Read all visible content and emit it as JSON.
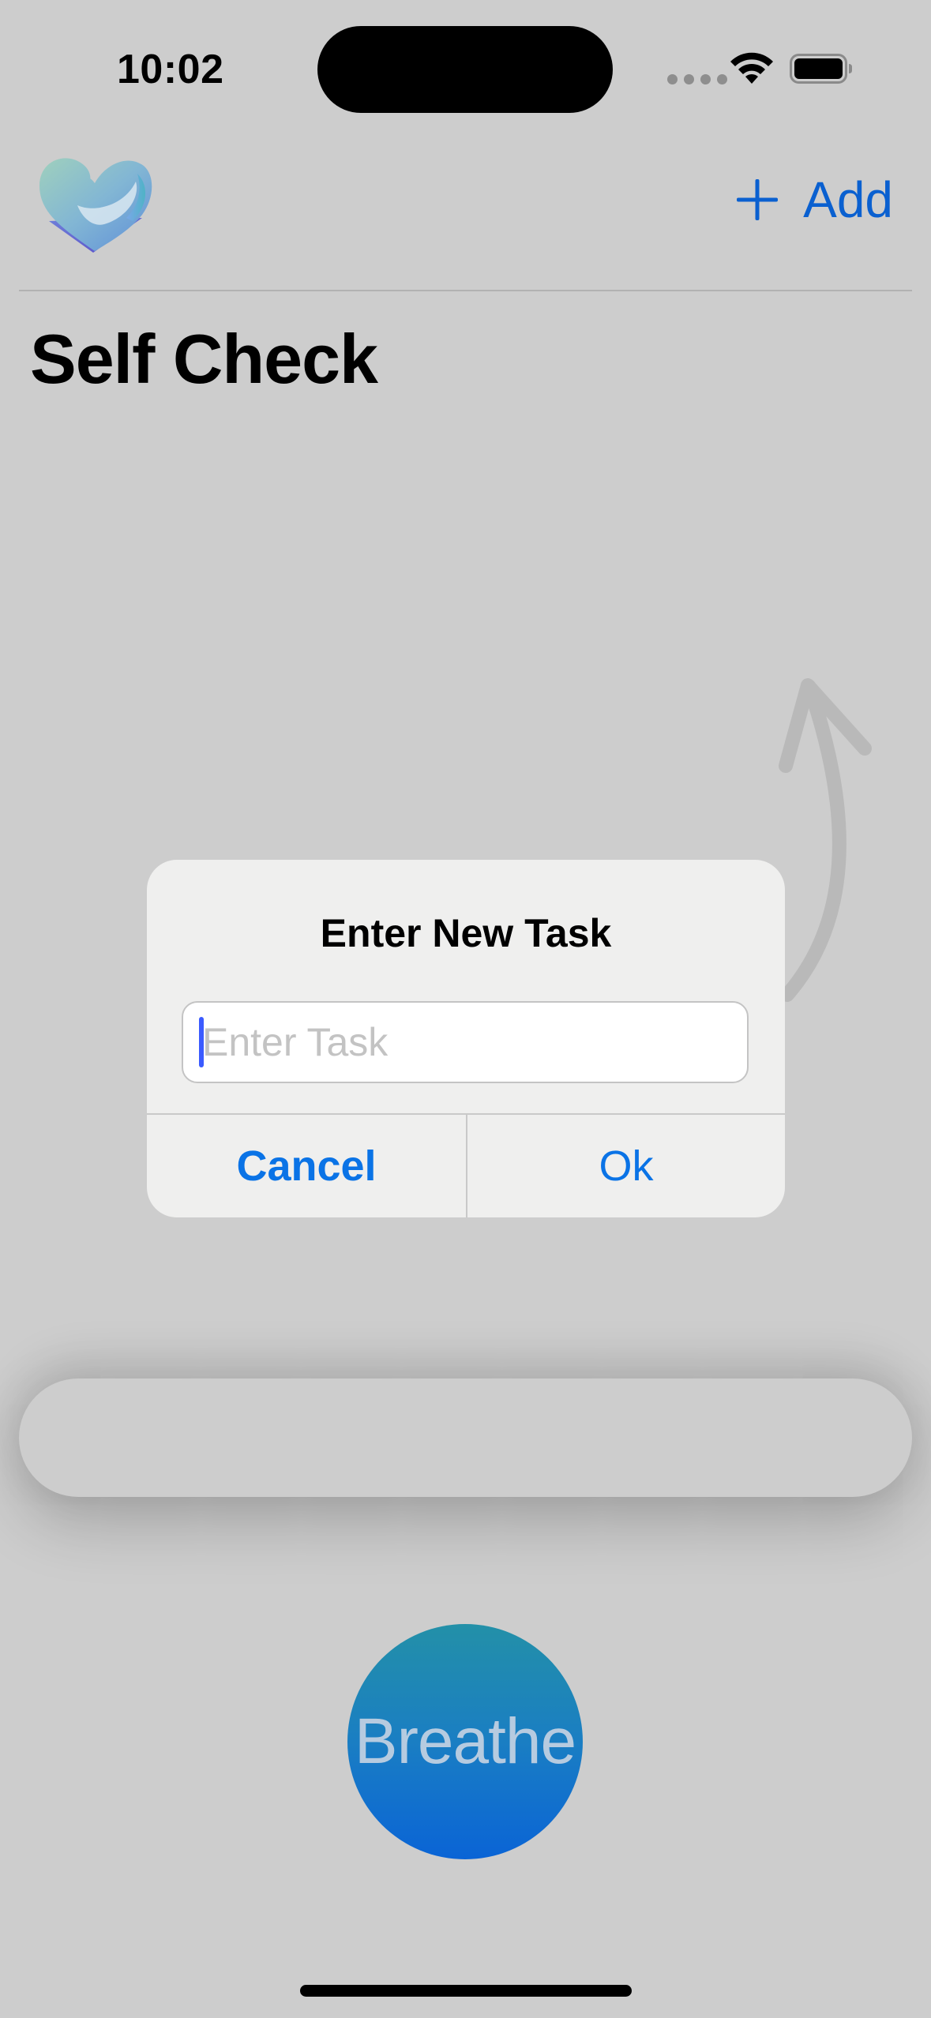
{
  "status_bar": {
    "time": "10:02",
    "icons": [
      "cellular-signal-icon",
      "wifi-icon",
      "battery-icon"
    ]
  },
  "header": {
    "logo": "heart-logo-icon",
    "add_label": "Add",
    "add_icon": "plus-icon"
  },
  "page": {
    "title": "Self Check"
  },
  "alert": {
    "title": "Enter New Task",
    "input_value": "",
    "input_placeholder": "Enter Task",
    "cancel_label": "Cancel",
    "ok_label": "Ok"
  },
  "breathe": {
    "label": "Breathe"
  },
  "colors": {
    "accent": "#0a60d0",
    "alert_button": "#0a73e6",
    "background": "#cdcdcd",
    "breathe_top": "#2390a8",
    "breathe_bottom": "#0a64d6"
  }
}
